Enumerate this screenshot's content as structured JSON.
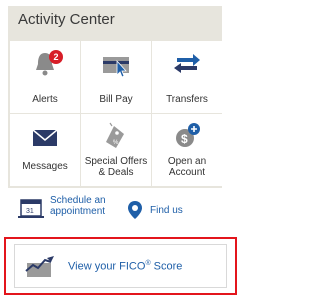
{
  "activity_center": {
    "title": "Activity Center",
    "alerts_badge": "2",
    "tiles": [
      {
        "label": "Alerts",
        "icon": "bell-icon"
      },
      {
        "label": "Bill Pay",
        "icon": "bill-pay-icon"
      },
      {
        "label": "Transfers",
        "icon": "transfer-arrows-icon"
      },
      {
        "label": "Messages",
        "icon": "envelope-icon"
      },
      {
        "label": "Special Offers\n& Deals",
        "icon": "tag-icon"
      },
      {
        "label": "Open an\nAccount",
        "icon": "dollar-plus-icon"
      }
    ]
  },
  "links": {
    "schedule": "Schedule an\nappointment",
    "find_us": "Find us"
  },
  "fico": {
    "text_before": "View your FICO",
    "registered": "®",
    "text_after": " Score"
  },
  "colors": {
    "brand_red": "#d71e28",
    "link_blue": "#1f5fa8",
    "icon_navy": "#2b3a67",
    "icon_gray": "#8a8a8a",
    "highlight_border": "#e3151c"
  }
}
